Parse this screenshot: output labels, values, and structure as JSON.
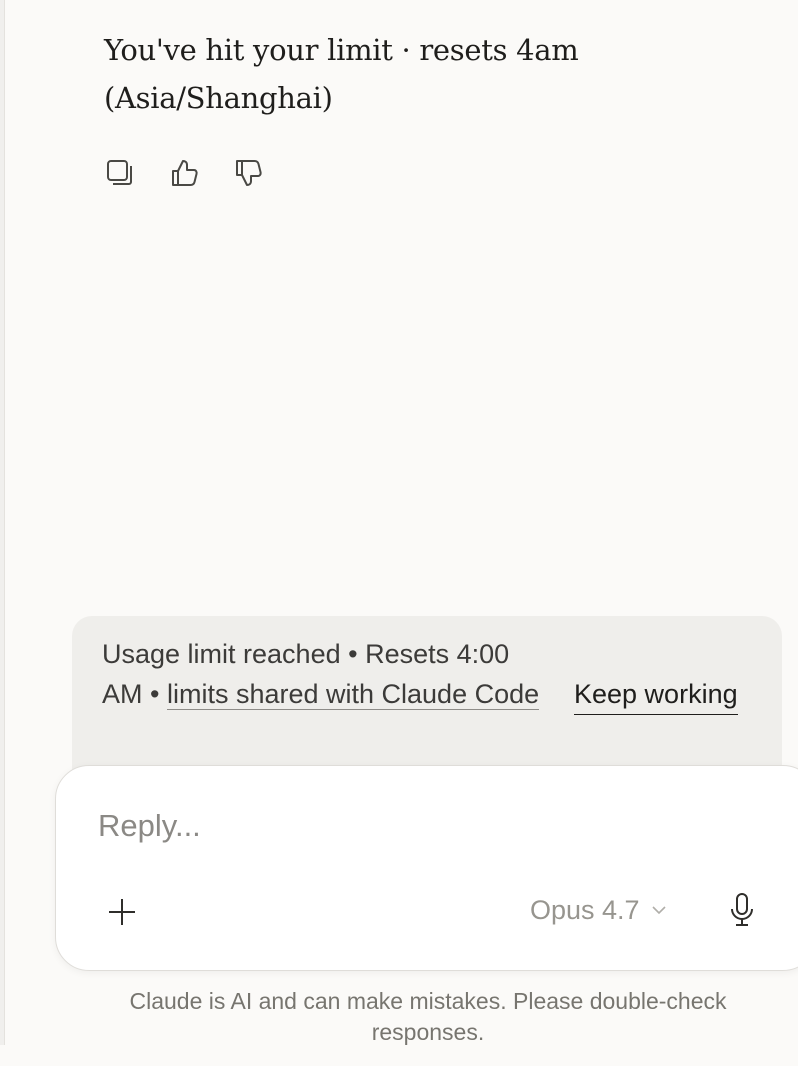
{
  "assistant_message": {
    "text": "You've hit your limit · resets 4am (Asia/Shanghai)"
  },
  "message_actions": {
    "copy_icon": "copy-icon",
    "thumbs_up_icon": "thumbs-up-icon",
    "thumbs_down_icon": "thumbs-down-icon"
  },
  "limit_banner": {
    "status_text": "Usage limit reached • Resets 4:00 AM • ",
    "link_text": "limits shared with Claude Code",
    "keep_working_label": "Keep working"
  },
  "composer": {
    "placeholder": "Reply...",
    "model_label": "Opus 4.7",
    "add_icon": "plus-icon",
    "model_dropdown_icon": "chevron-down-icon",
    "mic_icon": "microphone-icon"
  },
  "footer": {
    "disclaimer": "Claude is AI and can make mistakes. Please double-check responses."
  },
  "colors": {
    "page_background": "#fbfaf8",
    "banner_background": "#efeeeb",
    "composer_background": "#ffffff",
    "muted_text": "#8b8985"
  }
}
